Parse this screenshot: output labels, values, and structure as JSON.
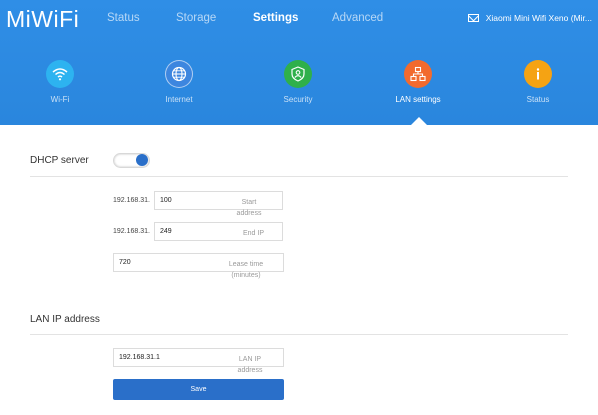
{
  "app": {
    "logo": "MiWiFi",
    "device_name": "Xiaomi Mini Wifi Xeno (Mir..."
  },
  "nav": {
    "items": [
      "Status",
      "Storage",
      "Settings",
      "Advanced"
    ],
    "active": "Settings"
  },
  "tiles": [
    {
      "label": "Wi-Fi",
      "icon": "wifi-icon",
      "color": "#2db3f0"
    },
    {
      "label": "Internet",
      "icon": "globe-icon",
      "color": "#3d86df"
    },
    {
      "label": "Security",
      "icon": "shield-icon",
      "color": "#2fb04b"
    },
    {
      "label": "LAN settings",
      "icon": "network-icon",
      "color": "#f26a2e"
    },
    {
      "label": "Status",
      "icon": "info-icon",
      "color": "#f5a313"
    }
  ],
  "dhcp": {
    "title": "DHCP server",
    "enabled": true,
    "prefix": "192.168.31.",
    "start_value": "100",
    "start_placeholder": "Start address",
    "end_value": "249",
    "end_placeholder": "End IP",
    "lease_value": "720",
    "lease_placeholder": "Lease time (minutes)"
  },
  "lan": {
    "title": "LAN IP address",
    "ip_value": "192.168.31.1",
    "ip_placeholder": "LAN IP address",
    "save_label": "Save"
  },
  "colors": {
    "header": "#2a86dd",
    "accent": "#2a6fc9"
  }
}
